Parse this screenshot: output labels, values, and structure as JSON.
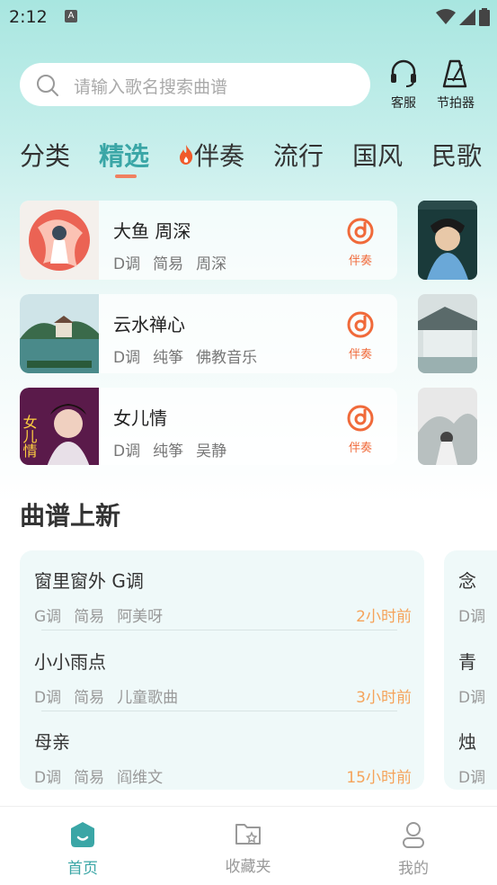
{
  "status_bar": {
    "time": "2:12",
    "notif_letter": "A"
  },
  "search": {
    "placeholder": "请输入歌名搜索曲谱"
  },
  "header_buttons": {
    "service": "客服",
    "metronome": "节拍器"
  },
  "tabs": [
    {
      "label": "分类"
    },
    {
      "label": "精选"
    },
    {
      "label": "伴奏"
    },
    {
      "label": "流行"
    },
    {
      "label": "国风"
    },
    {
      "label": "民歌"
    }
  ],
  "featured_songs": [
    {
      "title": "大鱼 周深",
      "key": "D调",
      "level": "简易",
      "tag": "周深",
      "action": "伴奏"
    },
    {
      "title": "云水禅心",
      "key": "D调",
      "level": "纯筝",
      "tag": "佛教音乐",
      "action": "伴奏"
    },
    {
      "title": "女儿情",
      "key": "D调",
      "level": "纯筝",
      "tag": "吴静",
      "action": "伴奏"
    }
  ],
  "thumb_texts": {
    "nuerqing": "女儿情"
  },
  "new_section": {
    "title": "曲谱上新",
    "items": [
      {
        "title": "窗里窗外 G调",
        "key": "G调",
        "level": "简易",
        "tag": "阿美呀",
        "time": "2小时前"
      },
      {
        "title": "小小雨点",
        "key": "D调",
        "level": "简易",
        "tag": "儿童歌曲",
        "time": "3小时前"
      },
      {
        "title": "母亲",
        "key": "D调",
        "level": "简易",
        "tag": "阎维文",
        "time": "15小时前"
      }
    ],
    "side_items": [
      {
        "title": "念",
        "meta": "D调"
      },
      {
        "title": "青",
        "meta": "D调"
      },
      {
        "title": "烛",
        "meta": "D调"
      }
    ]
  },
  "bottom_nav": {
    "home": "首页",
    "favorites": "收藏夹",
    "mine": "我的"
  },
  "colors": {
    "accent": "#3aa6a6",
    "orange": "#f06a3a",
    "time": "#f5a35a"
  }
}
